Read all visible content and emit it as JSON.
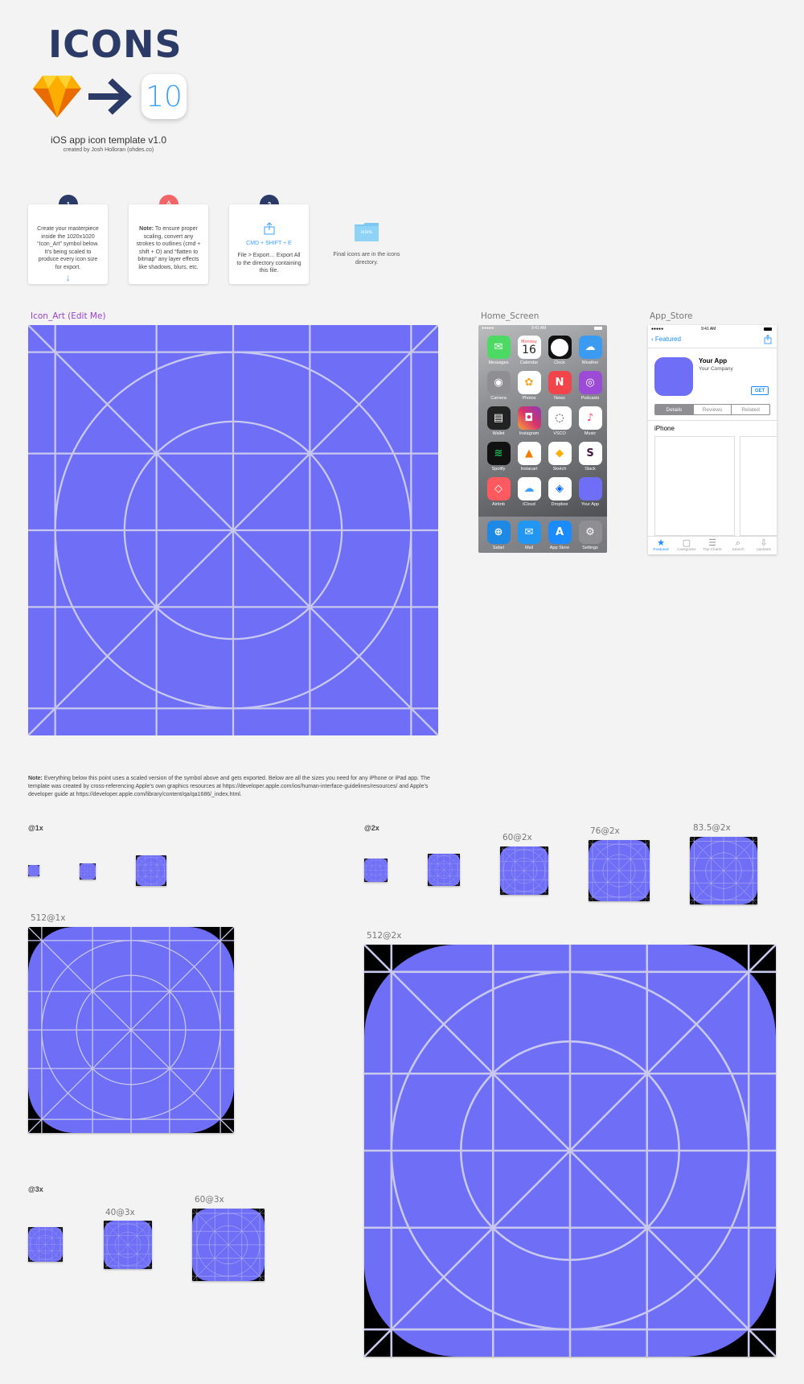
{
  "header": {
    "title": "ICONS",
    "ios_version": "10",
    "template_title": "iOS app icon template v1.0",
    "credit": "created by Josh Holloran (ohdes.co)"
  },
  "steps": [
    {
      "badge": "1",
      "text": "Create your masterpiece inside the 1020x1020 “Icon_Art” symbol below. It’s being scaled to produce every icon size for export."
    },
    {
      "badge": "!",
      "note_label": "Note:",
      "text": " To ensure proper scaling, convert any strokes to outlines (cmd + shift + O) and “flatten to bitmap” any layer effects like shadows, blurs, etc."
    },
    {
      "badge": "2",
      "shortcut": "CMD + SHIFT + E",
      "text": "File > Export… Export All to the directory containing this file."
    }
  ],
  "final": {
    "folder_label": "icons",
    "text": "Final icons are in the icons directory."
  },
  "artboards": {
    "icon_art": "Icon_Art (Edit Me)",
    "home_screen": "Home_Screen",
    "app_store": "App_Store"
  },
  "home_screen": {
    "time": "9:41 AM",
    "calendar_day": "Monday",
    "calendar_date": "16",
    "apps": [
      {
        "name": "Messages",
        "color": "#4cd964",
        "glyph": "✉"
      },
      {
        "name": "Calendar",
        "color": "#ffffff",
        "glyph": ""
      },
      {
        "name": "Clock",
        "color": "#111111",
        "glyph": "◷"
      },
      {
        "name": "Weather",
        "color": "#3a9bf0",
        "glyph": "☁"
      },
      {
        "name": "Camera",
        "color": "#8e8e93",
        "glyph": "◉"
      },
      {
        "name": "Photos",
        "color": "#ffffff",
        "glyph": "✿"
      },
      {
        "name": "News",
        "color": "#f2454b",
        "glyph": "N"
      },
      {
        "name": "Podcasts",
        "color": "#9b4bd6",
        "glyph": "◎"
      },
      {
        "name": "Wallet",
        "color": "#222222",
        "glyph": "▤"
      },
      {
        "name": "Instagram",
        "color": "#d6336c",
        "glyph": "◘"
      },
      {
        "name": "VSCO",
        "color": "#ffffff",
        "glyph": "◌"
      },
      {
        "name": "Music",
        "color": "#ffffff",
        "glyph": "♪"
      },
      {
        "name": "Spotify",
        "color": "#1db954",
        "glyph": "≋"
      },
      {
        "name": "Instacart",
        "color": "#ffffff",
        "glyph": "▲"
      },
      {
        "name": "Sketch",
        "color": "#ffffff",
        "glyph": "◆"
      },
      {
        "name": "Slack",
        "color": "#ffffff",
        "glyph": "S"
      },
      {
        "name": "Airbnb",
        "color": "#ff5a5f",
        "glyph": "◇"
      },
      {
        "name": "iCloud",
        "color": "#ffffff",
        "glyph": "☁"
      },
      {
        "name": "Dropbox",
        "color": "#ffffff",
        "glyph": "◈"
      },
      {
        "name": "Your App",
        "color": "#6f6ef6",
        "glyph": ""
      }
    ],
    "dock": [
      {
        "name": "Safari",
        "color": "#1e88e5",
        "glyph": "⊕"
      },
      {
        "name": "Mail",
        "color": "#2196f3",
        "glyph": "✉"
      },
      {
        "name": "App Store",
        "color": "#1a8cff",
        "glyph": "A"
      },
      {
        "name": "Settings",
        "color": "#8e8e93",
        "glyph": "⚙"
      }
    ]
  },
  "app_store": {
    "time": "9:41 AM",
    "back_label": "Featured",
    "app_name": "Your App",
    "company": "Your Company",
    "get_label": "GET",
    "segments": [
      "Details",
      "Reviews",
      "Related"
    ],
    "device_label": "iPhone",
    "tabs": [
      "Featured",
      "Categories",
      "Top Charts",
      "Search",
      "Updates"
    ]
  },
  "note": {
    "label": "Note:",
    "text": " Everything below this point uses a scaled version of the symbol above and gets exported. Below are all the sizes you need for any iPhone or iPad app. The template was created by cross-referencing Apple’s own graphics resources at https://developer.apple.com/ios/human-interface-guidelines/resources/ and Apple’s developer guide at https://developer.apple.com/library/content/qa/qa1686/_index.html."
  },
  "sizes": {
    "x1_head": "@1x",
    "x2_head": "@2x",
    "x3_head": "@3x",
    "label_512_1x": "512@1x",
    "label_512_2x": "512@2x",
    "label_60_2x": "60@2x",
    "label_76_2x": "76@2x",
    "label_83_2x": "83.5@2x",
    "label_40_3x": "40@3x",
    "label_60_3x": "60@3x"
  },
  "colors": {
    "icon_fill": "#6f6ef6",
    "grid_line": "#c9c8ef",
    "brand_dark": "#2b3a66",
    "accent_blue": "#3aa0ff"
  }
}
